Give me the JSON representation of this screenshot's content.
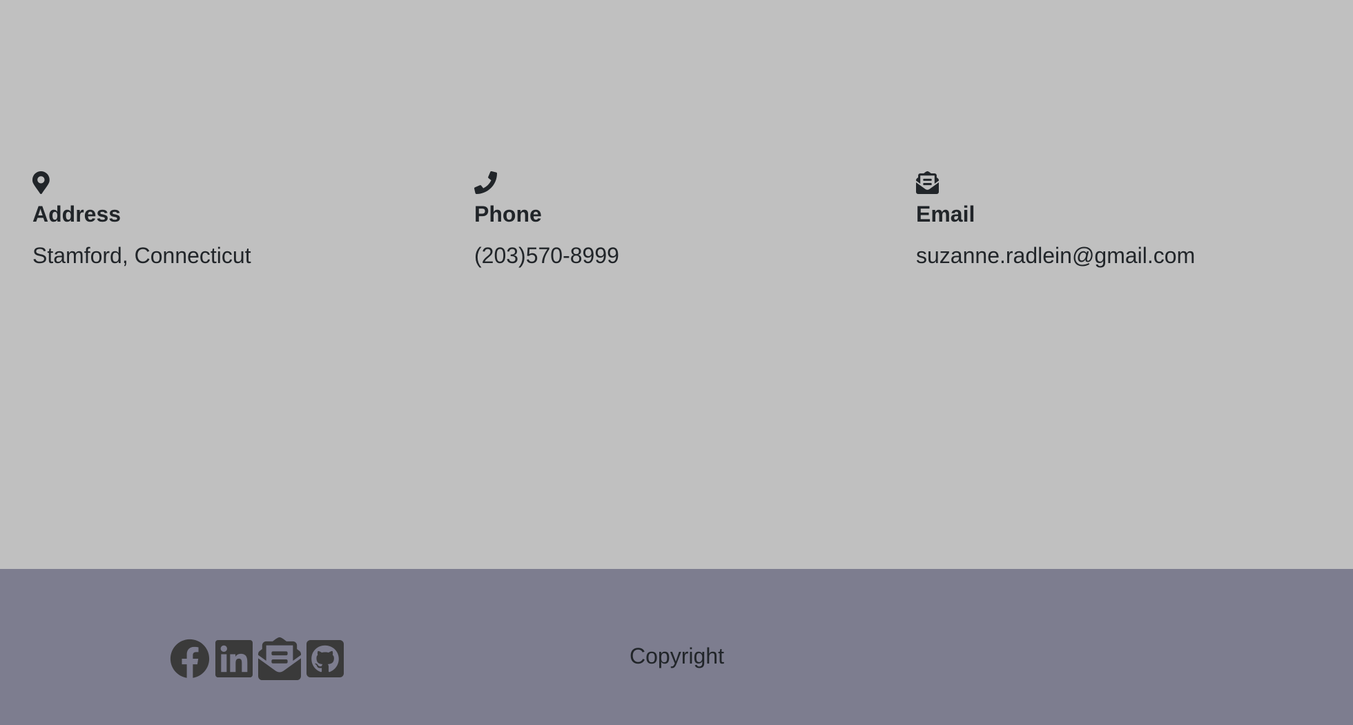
{
  "contact": {
    "address": {
      "icon": "map-pin-icon",
      "heading": "Address",
      "value": "Stamford, Connecticut"
    },
    "phone": {
      "icon": "phone-icon",
      "heading": "Phone",
      "value": "(203)570-8999"
    },
    "email": {
      "icon": "envelope-open-text-icon",
      "heading": "Email",
      "value": "suzanne.radlein@gmail.com"
    }
  },
  "footer": {
    "social": [
      {
        "icon": "facebook-icon"
      },
      {
        "icon": "linkedin-icon"
      },
      {
        "icon": "envelope-open-text-icon"
      },
      {
        "icon": "github-icon"
      }
    ],
    "copyright": "Copyright"
  },
  "colors": {
    "contact_background": "#c0c0c0",
    "footer_background": "#7d7d8f",
    "text": "#212529",
    "icon_dark": "#3a3a3a"
  }
}
